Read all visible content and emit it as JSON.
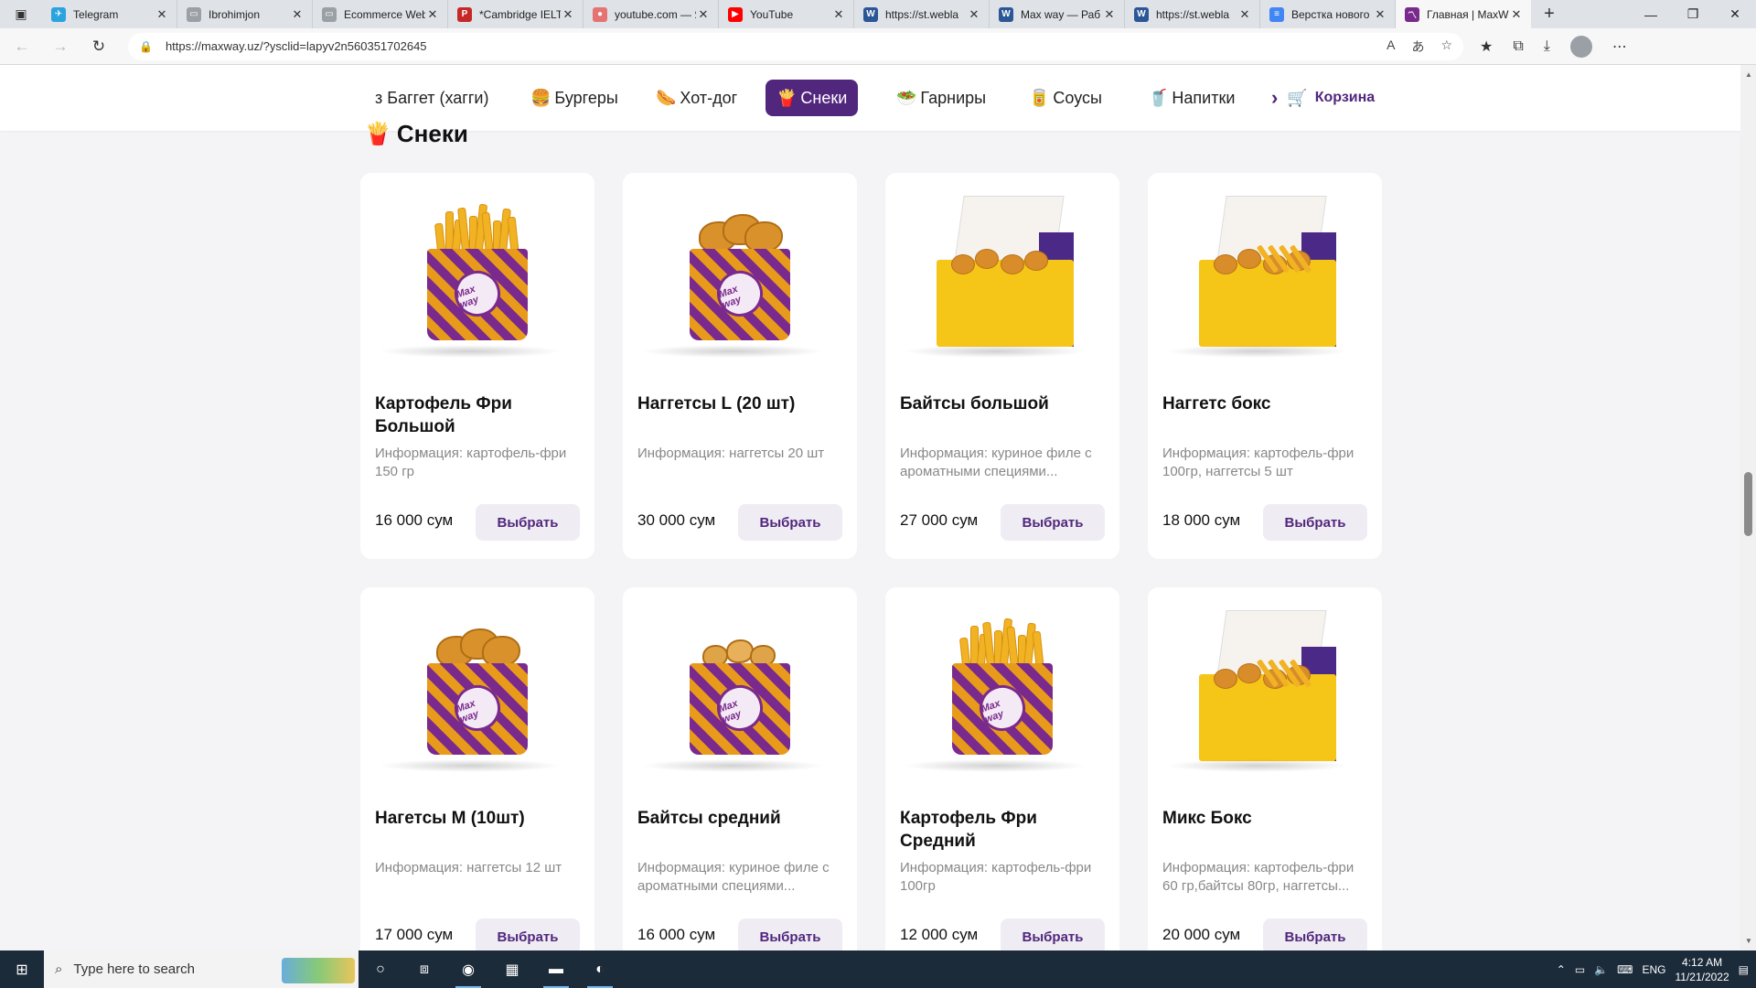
{
  "browser": {
    "tabs": [
      {
        "title": "Telegram",
        "color": "#2aa3df",
        "glyph": "✈"
      },
      {
        "title": "Ibrohimjon",
        "color": "#9aa0a6",
        "glyph": "▭"
      },
      {
        "title": "Ecommerce Web",
        "color": "#9aa0a6",
        "glyph": "▭"
      },
      {
        "title": "*Cambridge IELT",
        "color": "#c62828",
        "glyph": "P"
      },
      {
        "title": "youtube.com — Я",
        "color": "#e57373",
        "glyph": "●"
      },
      {
        "title": "YouTube",
        "color": "#ff0000",
        "glyph": "▶"
      },
      {
        "title": "https://st.webla",
        "color": "#2b5797",
        "glyph": "W"
      },
      {
        "title": "Max way — Раб",
        "color": "#2b5797",
        "glyph": "W"
      },
      {
        "title": "https://st.webla",
        "color": "#2b5797",
        "glyph": "W"
      },
      {
        "title": "Верстка нового",
        "color": "#4285f4",
        "glyph": "≡"
      },
      {
        "title": "Главная | MaxW",
        "color": "#7a2a8c",
        "glyph": "〽"
      }
    ],
    "url": "https://maxway.uz/?ysclid=lapyv2n560351702645"
  },
  "categories": [
    {
      "label": "з Баггет (хагги)",
      "icon": "",
      "active": false
    },
    {
      "label": "Бургеры",
      "icon": "🍔",
      "active": false
    },
    {
      "label": "Хот-дог",
      "icon": "🌭",
      "active": false
    },
    {
      "label": "Снеки",
      "icon": "🍟",
      "active": true
    },
    {
      "label": "Гарниры",
      "icon": "🥗",
      "active": false
    },
    {
      "label": "Соусы",
      "icon": "🥫",
      "active": false
    },
    {
      "label": "Напитки",
      "icon": "🥤",
      "active": false
    }
  ],
  "cart": {
    "label": "Корзина"
  },
  "section": {
    "title": "Снеки",
    "icon": "🍟"
  },
  "products": [
    {
      "name": "Картофель Фри Большой",
      "desc": "Информация: картофель-фри 150 гр",
      "price": "16 000 сум",
      "button": "Выбрать",
      "image": "fries"
    },
    {
      "name": "Наггетсы L (20 шт)",
      "desc": "Информация: наггетсы 20 шт",
      "price": "30 000 сум",
      "button": "Выбрать",
      "image": "nuggets"
    },
    {
      "name": "Байтсы большой",
      "desc": "Информация: куриное филе с ароматными специями...",
      "price": "27 000 сум",
      "button": "Выбрать",
      "image": "box-bites"
    },
    {
      "name": "Наггетс бокс",
      "desc": "Информация: картофель-фри 100гр, наггетсы 5 шт",
      "price": "18 000 сум",
      "button": "Выбрать",
      "image": "box-mix"
    },
    {
      "name": "Нагетсы М (10шт)",
      "desc": "Информация: наггетсы 12 шт",
      "price": "17 000 сум",
      "button": "Выбрать",
      "image": "nuggets"
    },
    {
      "name": "Байтсы средний",
      "desc": "Информация: куриное филе с ароматными специями...",
      "price": "16 000 сум",
      "button": "Выбрать",
      "image": "bites-cup"
    },
    {
      "name": "Картофель Фри Средний",
      "desc": "Информация: картофель-фри 100гр",
      "price": "12 000 сум",
      "button": "Выбрать",
      "image": "fries"
    },
    {
      "name": "Микс Бокс",
      "desc": "Информация: картофель-фри 60 гр,байтсы 80гр, наггетсы...",
      "price": "20 000 сум",
      "button": "Выбрать",
      "image": "box-mix"
    }
  ],
  "taskbar": {
    "search_placeholder": "Type here to search",
    "lang": "ENG",
    "time": "4:12 AM",
    "date": "11/21/2022"
  },
  "colors": {
    "brand": "#51267d",
    "button_bg": "#efedf3"
  }
}
